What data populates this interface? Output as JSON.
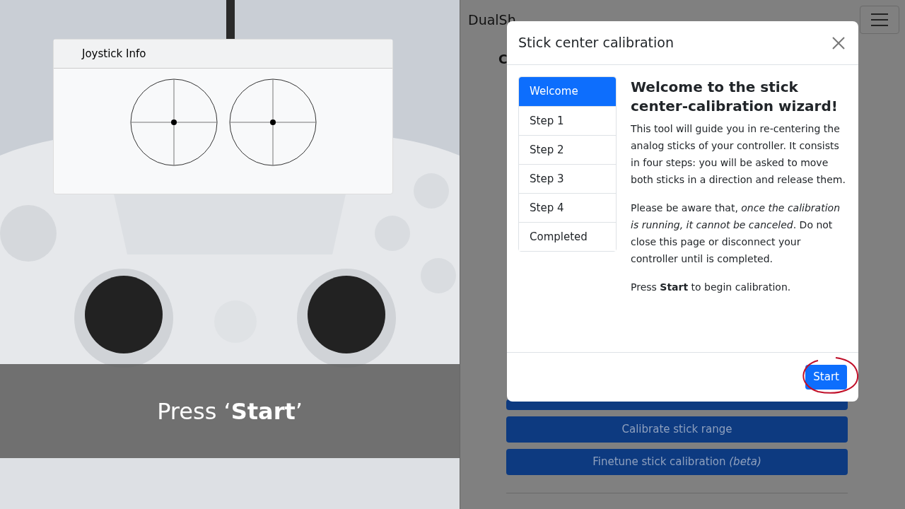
{
  "joystick_window": {
    "title": "Joystick Info"
  },
  "caption": "Press ‘**Start**’",
  "page": {
    "title": "DualSh",
    "heading_fragment": "C",
    "buttons": [
      {
        "label": "Calibrate stick range"
      },
      {
        "label": "Finetune stick calibration *(beta)*"
      }
    ]
  },
  "modal": {
    "title": "Stick center calibration",
    "steps": [
      {
        "label": "Welcome",
        "selected": true
      },
      {
        "label": "Step 1",
        "selected": false
      },
      {
        "label": "Step 2",
        "selected": false
      },
      {
        "label": "Step 3",
        "selected": false
      },
      {
        "label": "Step 4",
        "selected": false
      },
      {
        "label": "Completed",
        "selected": false
      }
    ],
    "heading": "Welcome to the stick center-calibration wizard!",
    "paragraphs": [
      "This tool will guide you in re-centering the analog sticks of your controller. It consists in four steps: you will be asked to move both sticks in a direction and release them.",
      "Please be aware that, *once the calibration is running, it cannot be canceled*. Do not close this page or disconnect your controller until is completed.",
      "Press **Start** to begin calibration."
    ],
    "start_button": "Start"
  }
}
